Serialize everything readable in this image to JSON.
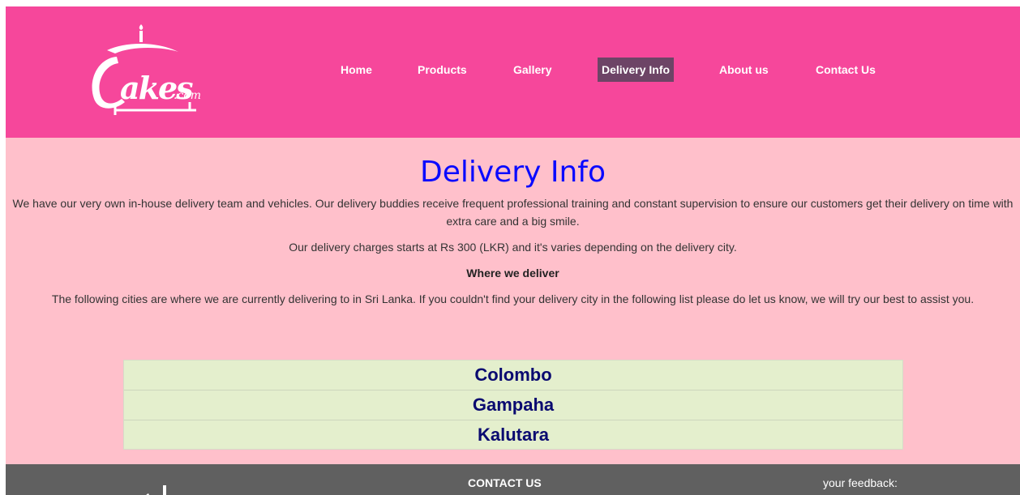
{
  "header": {
    "logo_text": "Cakes.com",
    "nav": [
      {
        "label": "Home"
      },
      {
        "label": "Products"
      },
      {
        "label": "Gallery"
      },
      {
        "label": "Delivery Info",
        "active": true
      },
      {
        "label": "About us"
      },
      {
        "label": "Contact Us"
      }
    ]
  },
  "main": {
    "title": "Delivery Info",
    "paragraph1": "We have our very own in-house delivery team and vehicles. Our delivery buddies receive frequent professional training and constant supervision to ensure our customers get their delivery on time with extra care and a big smile.",
    "paragraph2": "Our delivery charges starts at Rs 300 (LKR) and it's varies depending on the delivery city.",
    "subheading": "Where we deliver",
    "paragraph3": "The following cities are where we are currently delivering to in Sri Lanka. If you couldn't find your delivery city in the following list please do let us know, we will try our best to assist you.",
    "cities": [
      "Colombo",
      "Gampaha",
      "Kalutara"
    ]
  },
  "footer": {
    "contact_heading": "CONTACT US",
    "feedback_label": "your feedback:"
  },
  "colors": {
    "header_bg": "#f6479b",
    "active_nav_bg": "#6d4466",
    "content_bg": "#ffc0cb",
    "title_color": "#0a0aff",
    "table_bg": "#e4efcd",
    "city_text": "#0a0a70",
    "footer_bg": "#606060"
  }
}
